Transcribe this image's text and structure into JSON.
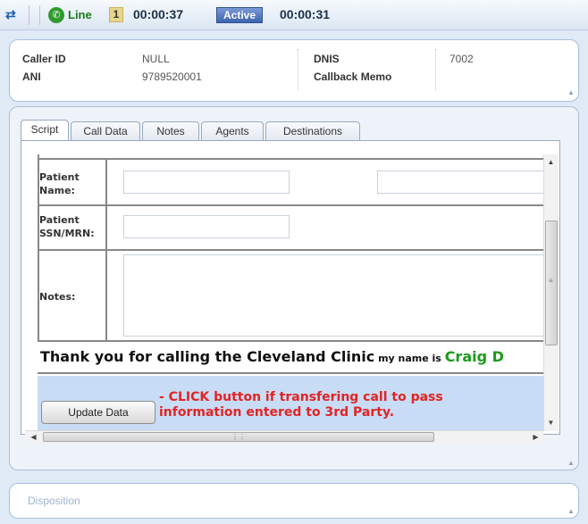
{
  "topbar": {
    "line_label": "Line",
    "line_number": "1",
    "call_timer": "00:00:37",
    "status": "Active",
    "status_timer": "00:00:31"
  },
  "caller_info": {
    "caller_id_label": "Caller ID",
    "caller_id_value": "NULL",
    "dnis_label": "DNIS",
    "dnis_value": "7002",
    "ani_label": "ANI",
    "ani_value": "9789520001",
    "callback_memo_label": "Callback Memo",
    "callback_memo_value": ""
  },
  "tabs": [
    {
      "label": "Script",
      "active": true
    },
    {
      "label": "Call Data",
      "active": false
    },
    {
      "label": "Notes",
      "active": false
    },
    {
      "label": "Agents",
      "active": false
    },
    {
      "label": "Destinations",
      "active": false
    }
  ],
  "script_form": {
    "patient_name_label_1": "Patient",
    "patient_name_label_2": "Name:",
    "first_name_value": "",
    "last_name_value": "",
    "patient_ssn_label_1": "Patient",
    "patient_ssn_label_2": "SSN/MRN:",
    "ssn_value": "",
    "notes_label": "Notes:",
    "notes_value": "",
    "thanks_main": "Thank you for calling the Cleveland Clinic",
    "thanks_small": " my name is ",
    "thanks_name": "Craig D",
    "update_button_label": "Update Data",
    "update_hint_line1": "- CLICK button if transfering call to pass",
    "update_hint_line2": "information entered to 3rd Party."
  },
  "disposition": {
    "label": "Disposition"
  },
  "colors": {
    "accent_blue": "#3d64b0",
    "hint_red": "#e02424",
    "name_green": "#1c9a1c",
    "action_band": "#c9dcf5"
  },
  "icons": {
    "topbar_left": "swap-arrows-icon",
    "line": "phone-icon",
    "collapse": "chevron-up-icon"
  }
}
